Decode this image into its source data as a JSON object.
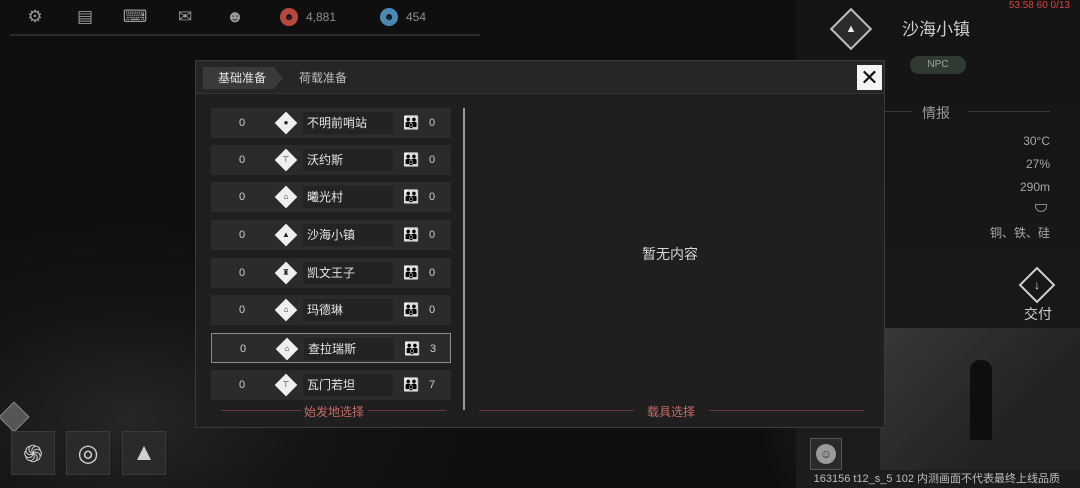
{
  "top_bar": {
    "icons": [
      "gear-icon",
      "chat-icon",
      "keyboard-icon",
      "mail-icon",
      "friends-icon"
    ],
    "resource_red": {
      "icon": "person-red-icon",
      "value": "4,881",
      "color": "#b8473e"
    },
    "resource_blue": {
      "icon": "person-blue-icon",
      "value": "454",
      "color": "#4b89b3"
    }
  },
  "debug": {
    "coords": "53.58 60 0/13"
  },
  "info_panel": {
    "town_name": "沙海小镇",
    "badge": "NPC",
    "section_title": "情报",
    "stats": [
      "30°C",
      "27%",
      "290m",
      "铜、铁、硅"
    ],
    "deliver_label": "交付"
  },
  "footer_note": "163156 t12_s_5 102  内测画面不代表最终上线品质",
  "modal": {
    "tabs": [
      "基础准备",
      "荷载准备"
    ],
    "close_label": "✕",
    "departure_rows": [
      {
        "left": "0",
        "name": "不明前哨站",
        "right": "0",
        "icon_glyph": "●"
      },
      {
        "left": "0",
        "name": "沃约斯",
        "right": "0",
        "icon_glyph": "⊤"
      },
      {
        "left": "0",
        "name": "曦光村",
        "right": "0",
        "icon_glyph": "⌂"
      },
      {
        "left": "0",
        "name": "沙海小镇",
        "right": "0",
        "icon_glyph": "▲"
      },
      {
        "left": "0",
        "name": "凯文王子",
        "right": "0",
        "icon_glyph": "♜"
      },
      {
        "left": "0",
        "name": "玛德琳",
        "right": "0",
        "icon_glyph": "⌂"
      },
      {
        "left": "0",
        "name": "查拉瑞斯",
        "right": "3",
        "icon_glyph": "⌂"
      },
      {
        "left": "0",
        "name": "瓦门若坦",
        "right": "7",
        "icon_glyph": "⊤"
      }
    ],
    "departure_section_label": "始发地选择",
    "vehicle_section_label": "载具选择",
    "empty_text": "暂无内容"
  },
  "bottom_tools": [
    "galaxy-swirl-icon",
    "planet-orbit-icon",
    "mountain-icon"
  ]
}
